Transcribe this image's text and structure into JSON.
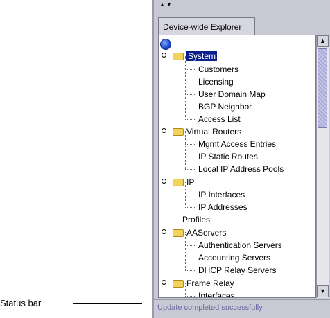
{
  "annotation": {
    "status_bar_label": "Status bar"
  },
  "panel": {
    "tab_label": "Device-wide Explorer"
  },
  "tree": {
    "items": [
      {
        "label": "System",
        "selected": true
      },
      {
        "label": "Customers"
      },
      {
        "label": "Licensing"
      },
      {
        "label": "User Domain Map"
      },
      {
        "label": "BGP Neighbor"
      },
      {
        "label": "Access List"
      },
      {
        "label": "Virtual Routers"
      },
      {
        "label": "Mgmt Access Entries"
      },
      {
        "label": "IP Static Routes"
      },
      {
        "label": "Local IP Address Pools"
      },
      {
        "label": "IP"
      },
      {
        "label": "IP Interfaces"
      },
      {
        "label": "IP Addresses"
      },
      {
        "label": "Profiles"
      },
      {
        "label": "AAServers"
      },
      {
        "label": "Authentication Servers"
      },
      {
        "label": "Accounting Servers"
      },
      {
        "label": "DHCP Relay Servers"
      },
      {
        "label": "Frame Relay"
      },
      {
        "label": "Interfaces"
      }
    ]
  },
  "statusbar": {
    "message": "Update completed successfully."
  },
  "colors": {
    "selection": "#0a1f8c",
    "folder": "#f2d35b",
    "status_text": "#6a6aa0",
    "chrome": "#c9c9d6"
  },
  "icons": {
    "root": "globe-icon",
    "group": "folder-icon",
    "expander": "key-icon"
  }
}
